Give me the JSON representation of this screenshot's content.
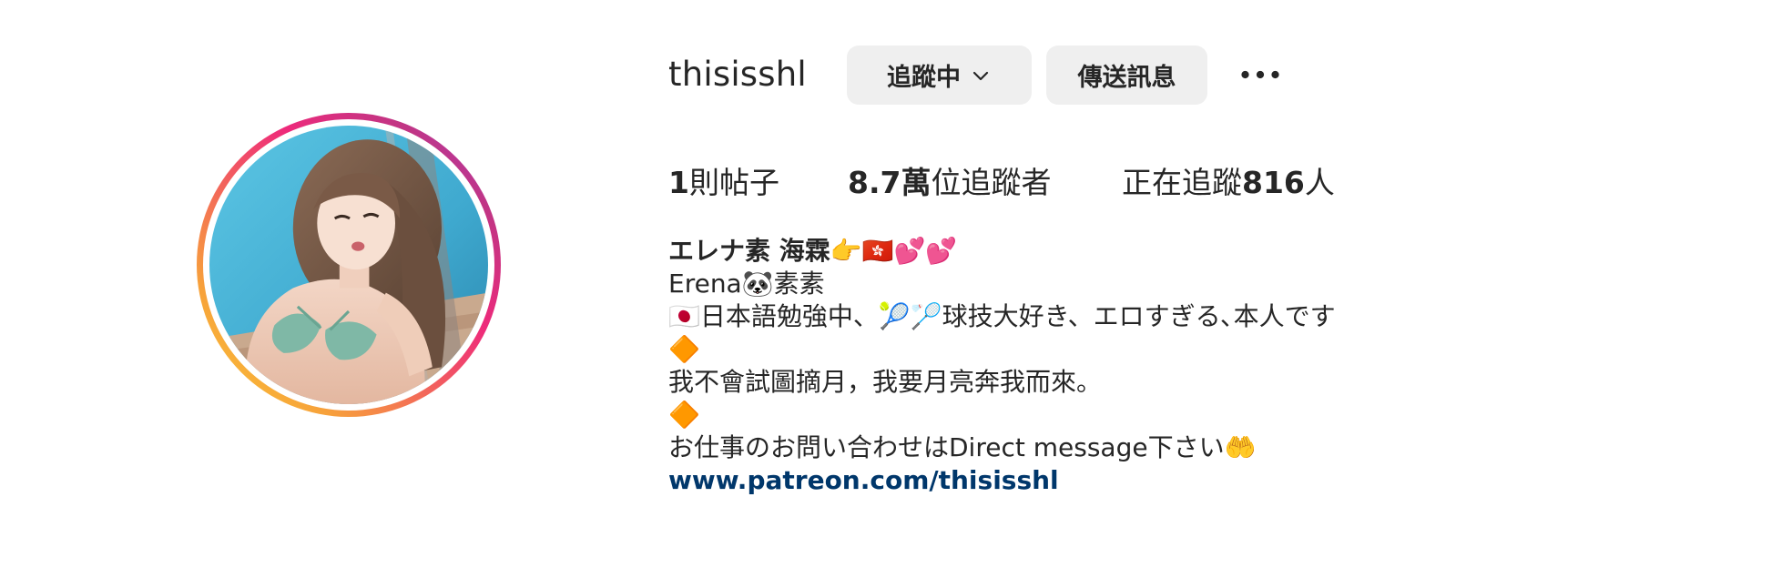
{
  "profile": {
    "username": "thisisshl",
    "following_button_label": "追蹤中",
    "message_button_label": "傳送訊息",
    "more_icon": "more-horizontal-icon"
  },
  "stats": {
    "posts_count": "1",
    "posts_label": "則帖子",
    "followers_count": "8.7萬",
    "followers_label": "位追蹤者",
    "following_prefix": "正在追蹤",
    "following_count": "816",
    "following_suffix": "人"
  },
  "bio": {
    "display_name": "エレナ素 海霖👉🇭🇰💕💕",
    "line1": "Erena🐼素素",
    "line2": "🇯🇵日本語勉強中、🎾🏸球技大好き、エロすぎる､本人です",
    "line3": "🔶",
    "line4": "我不會試圖摘月，我要月亮奔我而來。",
    "line5": "🔶",
    "line6": "お仕事のお問い合わせはDirect message下さい🤲",
    "link": "www.patreon.com/thisisshl"
  },
  "colors": {
    "button_bg": "#efefef",
    "link": "#00376b",
    "text": "#262626",
    "story_ring_start": "#f9ce34",
    "story_ring_end": "#a23ccd"
  }
}
